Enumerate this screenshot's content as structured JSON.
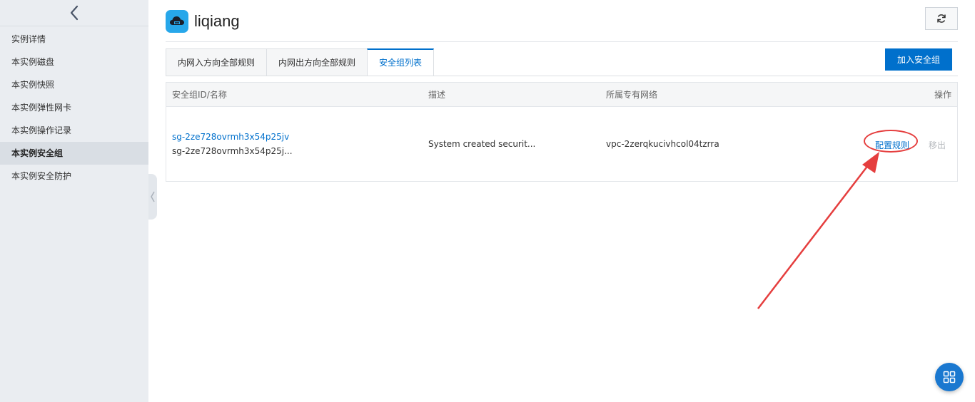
{
  "sidebar": {
    "items": [
      {
        "label": "实例详情"
      },
      {
        "label": "本实例磁盘"
      },
      {
        "label": "本实例快照"
      },
      {
        "label": "本实例弹性网卡"
      },
      {
        "label": "本实例操作记录"
      },
      {
        "label": "本实例安全组",
        "active": true
      },
      {
        "label": "本实例安全防护"
      }
    ]
  },
  "header": {
    "title": "liqiang",
    "icon": "cloud-server-icon",
    "refresh_icon": "refresh-icon"
  },
  "tabs": [
    {
      "label": "内网入方向全部规则"
    },
    {
      "label": "内网出方向全部规则"
    },
    {
      "label": "安全组列表",
      "active": true
    }
  ],
  "toolbar": {
    "add_label": "加入安全组"
  },
  "table": {
    "columns": [
      "安全组ID/名称",
      "描述",
      "所属专有网络",
      "操作"
    ],
    "rows": [
      {
        "id": "sg-2ze728ovrmh3x54p25jv",
        "name": "sg-2ze728ovrmh3x54p25j...",
        "description": "System created securit...",
        "vpc": "vpc-2zerqkucivhcol04tzrra",
        "actions": {
          "configure": "配置规则",
          "remove": "移出"
        }
      }
    ]
  },
  "colors": {
    "primary": "#0070cc",
    "sidebar_bg": "#eaedf1",
    "annotation": "#e53e3e"
  }
}
